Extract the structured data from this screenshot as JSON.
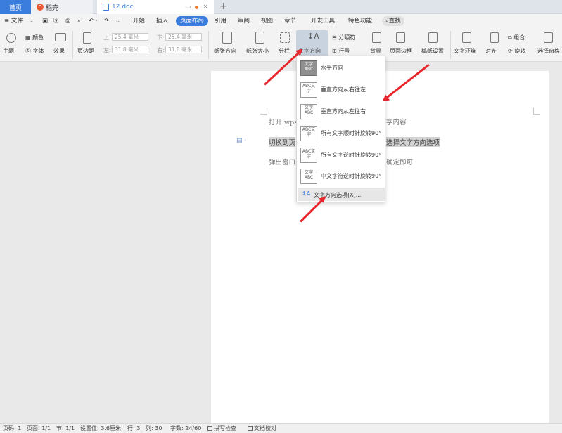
{
  "tabs": {
    "home": "首页",
    "docer": "稻壳",
    "doc": "12.doc",
    "new": "+"
  },
  "menu": {
    "file": "≡ 文件",
    "items": [
      "开始",
      "插入",
      "页面布局",
      "引用",
      "审阅",
      "视图",
      "章节",
      "开发工具",
      "特色功能"
    ],
    "search": "查找"
  },
  "ribbon": {
    "theme": "主题",
    "colors": "颜色",
    "fonts": "字体",
    "effects": "效果",
    "margins": "页边距",
    "top_label": "上:",
    "top_value": "25.4 毫米",
    "bottom_label": "下:",
    "bottom_value": "25.4 毫米",
    "left_label": "左:",
    "left_value": "31.8 毫米",
    "right_label": "右:",
    "right_value": "31.8 毫米",
    "orientation": "纸张方向",
    "size": "纸张大小",
    "columns": "分栏",
    "text_direction": "文字方向",
    "breaks": "分隔符",
    "line_numbers": "行号",
    "background": "背景",
    "borders": "页面边框",
    "manuscript": "稿纸设置",
    "wrap": "文字环绕",
    "align": "对齐",
    "group": "组合",
    "rotate": "旋转",
    "selection_pane": "选择窗格"
  },
  "dropdown": {
    "items": [
      {
        "label": "水平方向",
        "icon": "文字ABC"
      },
      {
        "label": "垂直方向从右往左",
        "icon": "ABC文字"
      },
      {
        "label": "垂直方向从左往右",
        "icon": "文字ABC"
      },
      {
        "label": "所有文字顺时针旋转90°",
        "icon": "ABC文字"
      },
      {
        "label": "所有文字逆时针旋转90°",
        "icon": "ABC文字"
      },
      {
        "label": "中文字符逆时针旋转90°",
        "icon": "文字ABC"
      }
    ],
    "options": "文字方向选项(X)..."
  },
  "document": {
    "line1a": "打开 wps",
    "line1b": "字内容",
    "line2a": "切换到页",
    "line2b": "选择文字方向选项",
    "line3a": "弹出窗口",
    "line3b": "确定即可"
  },
  "status": {
    "page_num": "页码: 1",
    "pages": "页面: 1/1",
    "section": "节: 1/1",
    "setting": "设置值: 3.6厘米",
    "row": "行: 3",
    "col": "列: 30",
    "words": "字数: 24/60",
    "spell": "拼写检查",
    "proof": "文档校对"
  },
  "colors": {
    "accent": "#3b7ddd",
    "annotation": "#e8262b"
  }
}
